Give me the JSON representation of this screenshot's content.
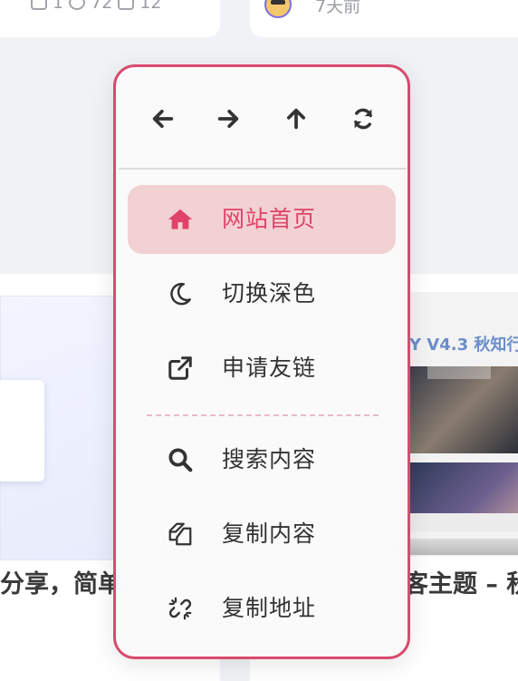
{
  "background": {
    "top_left_meta": {
      "comments": "1",
      "views": "72",
      "likes": "12"
    },
    "top_right_meta": {
      "time": "7天前"
    },
    "right_thumb_title": "Y V4.3 秋知行",
    "left_post_title": "分享，简单",
    "right_post_title": "客主题 – 秋"
  },
  "menu": {
    "nav": {
      "back_icon": "arrow-left-icon",
      "forward_icon": "arrow-right-icon",
      "up_icon": "arrow-up-icon",
      "refresh_icon": "refresh-icon"
    },
    "items": [
      {
        "label": "网站首页",
        "icon": "home-icon",
        "active": true
      },
      {
        "label": "切换深色",
        "icon": "moon-icon",
        "active": false
      },
      {
        "label": "申请友链",
        "icon": "external-link-icon",
        "active": false
      },
      {
        "label": "搜索内容",
        "icon": "search-icon",
        "active": false
      },
      {
        "label": "复制内容",
        "icon": "copy-icon",
        "active": false
      },
      {
        "label": "复制地址",
        "icon": "unlink-icon",
        "active": false
      }
    ]
  },
  "colors": {
    "accent": "#e0426a",
    "menu_border": "#d94b6d",
    "active_bg": "#f2d1d3",
    "icon": "#333333"
  }
}
